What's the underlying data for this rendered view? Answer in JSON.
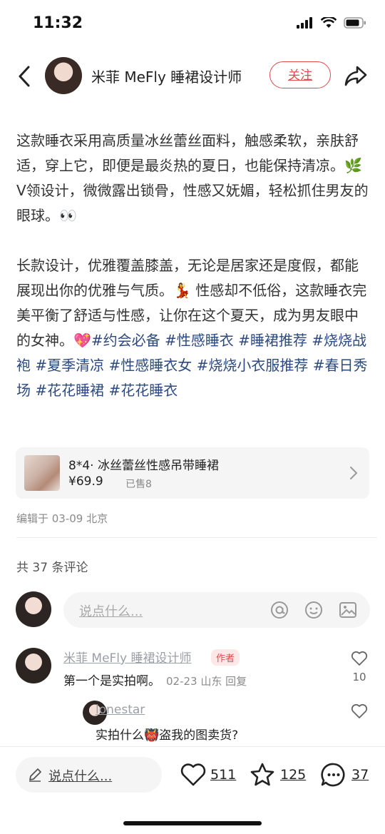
{
  "status": {
    "time": "11:32"
  },
  "header": {
    "author": "米菲 MeFly 睡裙设计师",
    "follow_label": "关注"
  },
  "post": {
    "paragraph1": "这款睡衣采用高质量冰丝蕾丝面料，触感柔软，亲肤舒适，穿上它，即便是最炎热的夏日，也能保持清凉。🌿 V领设计，微微露出锁骨，性感又妩媚，轻松抓住男友的眼球。👀",
    "paragraph2": "长款设计，优雅覆盖膝盖，无论是居家还是度假，都能展现出你的优雅与气质。💃 性感却不低俗，这款睡衣完美平衡了舒适与性感，让你在这个夏天，成为男友眼中的女神。💖",
    "tags": [
      "#约会必备",
      "#性感睡衣",
      "#睡裙推荐",
      "#烧烧战袍",
      "#夏季清凉",
      "#性感睡衣女",
      "#烧烧小衣服推荐",
      "#春日秀场",
      "#花花睡裙",
      "#花花睡衣"
    ]
  },
  "product": {
    "title": "8*4· 冰丝蕾丝性感吊带睡裙",
    "price": "¥69.9",
    "sold": "已售8"
  },
  "edit_info": "编辑于 03-09 北京",
  "comments_count": "共 37 条评论",
  "comment_input": {
    "placeholder": "说点什么..."
  },
  "comments": [
    {
      "name": "米菲 MeFly 睡裙设计师",
      "badge": "作者",
      "text": "第一个是实拍啊。",
      "meta": "02-23 山东 回复",
      "likes": "10"
    },
    {
      "name": "lonestar",
      "text": "实拍什么👹盗我的图卖货?"
    }
  ],
  "bottom_bar": {
    "placeholder": "说点什么...",
    "likes": "511",
    "stars": "125",
    "comments": "37"
  },
  "colors": {
    "accent": "#e5484d",
    "tag": "#2c4a7f"
  }
}
